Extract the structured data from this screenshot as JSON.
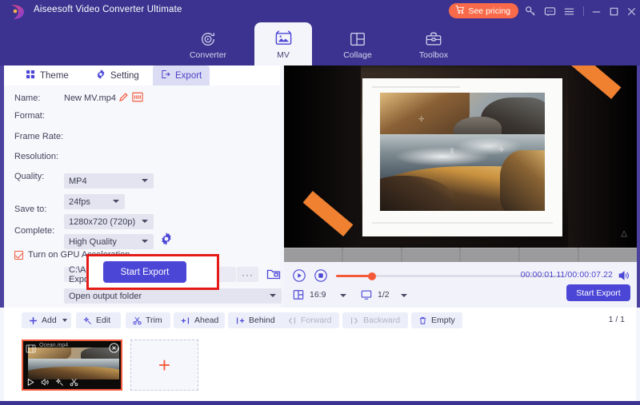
{
  "window": {
    "app_title": "Aiseesoft Video Converter Ultimate",
    "pricing_label": "See pricing",
    "icons": {
      "logo": "aiseesoft-logo-icon",
      "cart": "cart-icon",
      "key": "key-icon",
      "chat": "chat-icon",
      "menu": "hamburger-menu-icon",
      "minimize": "minimize-icon",
      "maximize": "maximize-icon",
      "close": "close-icon"
    }
  },
  "nav": {
    "items": [
      {
        "label": "Converter",
        "icon": "converter-icon",
        "active": false
      },
      {
        "label": "MV",
        "icon": "mv-icon",
        "active": true
      },
      {
        "label": "Collage",
        "icon": "collage-icon",
        "active": false
      },
      {
        "label": "Toolbox",
        "icon": "toolbox-icon",
        "active": false
      }
    ]
  },
  "panel": {
    "tabs": [
      {
        "label": "Theme",
        "icon": "grid-icon",
        "active": false
      },
      {
        "label": "Setting",
        "icon": "gear-icon",
        "active": false
      },
      {
        "label": "Export",
        "icon": "export-icon",
        "active": true
      }
    ],
    "fields": {
      "name_label": "Name:",
      "name_value": "New MV.mp4",
      "format_label": "Format:",
      "format_value": "MP4",
      "frame_rate_label": "Frame Rate:",
      "frame_rate_value": "24fps",
      "resolution_label": "Resolution:",
      "resolution_value": "1280x720 (720p)",
      "quality_label": "Quality:",
      "quality_value": "High Quality",
      "gpu_label": "Turn on GPU Acceleration",
      "save_to_label": "Save to:",
      "save_to_value": "C:\\Aiseesoft Studio\\A... Ultimate\\MV Exported",
      "dots_label": "···",
      "complete_label": "Complete:",
      "complete_value": "Open output folder"
    },
    "start_export_label": "Start Export"
  },
  "player": {
    "timecode": "00:00:01.11/00:00:07.22",
    "aspect_ratio": "16:9",
    "screen_scale": "1/2",
    "start_export_label": "Start Export"
  },
  "toolbar": {
    "items": [
      {
        "label": "Add",
        "icon": "plus-icon",
        "disabled": false,
        "caret": true
      },
      {
        "label": "Edit",
        "icon": "magic-wand-icon",
        "disabled": false,
        "caret": false
      },
      {
        "label": "Trim",
        "icon": "scissors-icon",
        "disabled": false,
        "caret": false
      },
      {
        "label": "Ahead",
        "icon": "insert-ahead-icon",
        "disabled": false,
        "caret": false
      },
      {
        "label": "Behind",
        "icon": "insert-behind-icon",
        "disabled": false,
        "caret": false
      },
      {
        "label": "Forward",
        "icon": "move-forward-icon",
        "disabled": true,
        "caret": false
      },
      {
        "label": "Backward",
        "icon": "move-backward-icon",
        "disabled": true,
        "caret": false
      },
      {
        "label": "Empty",
        "icon": "trash-icon",
        "disabled": false,
        "caret": false
      }
    ],
    "page_count": "1 / 1"
  },
  "thumbnails": {
    "clip_name": "Ocean.mp4",
    "add_label": "+"
  },
  "colors": {
    "brand_purple": "#3b338f",
    "accent_blue": "#4b46d6",
    "accent_orange": "#f4593a",
    "pricing_orange": "#f96a4a",
    "highlight_red": "#e41b17",
    "panel_bg": "#f7f8fc"
  }
}
